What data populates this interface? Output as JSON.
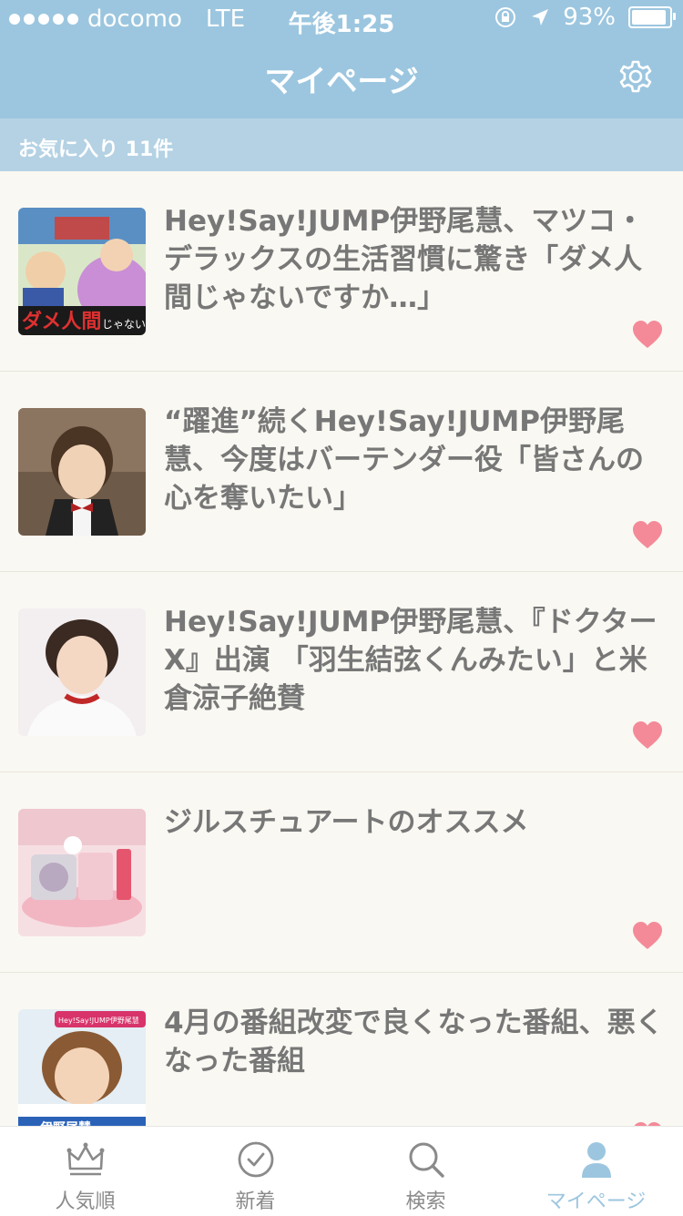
{
  "status": {
    "carrier": "docomo",
    "network": "LTE",
    "time": "午後1:25",
    "battery": "93%",
    "battery_level": 0.93
  },
  "nav": {
    "title": "マイページ",
    "settings_icon": "gear-icon"
  },
  "subheader": {
    "text": "お気に入り 11件"
  },
  "articles": [
    {
      "title": "Hey!Say!JUMP伊野尾慧、マツコ・デラックスの生活習慣に驚き「ダメ人間じゃないですか…」",
      "favorite": true
    },
    {
      "title": "“躍進”続くHey!Say!JUMP伊野尾慧、今度はバーテンダー役「皆さんの心を奪いたい」",
      "favorite": true
    },
    {
      "title": "Hey!Say!JUMP伊野尾慧、『ドクターX』出演 「羽生結弦くんみたい」と米倉涼子絶賛",
      "favorite": true
    },
    {
      "title": "ジルスチュアートのオススメ",
      "favorite": true
    },
    {
      "title": "4月の番組改変で良くなった番組、悪くなった番組",
      "favorite": true
    }
  ],
  "thumb_texts": {
    "t1": "ダメ人間",
    "t1_sub": "じゃない",
    "t5_banner": "Hey!Say!JUMP伊野尾慧",
    "t5_name": "伊野尾慧"
  },
  "tabs": [
    {
      "label": "人気順",
      "icon": "crown-icon"
    },
    {
      "label": "新着",
      "icon": "clock-icon"
    },
    {
      "label": "検索",
      "icon": "search-icon"
    },
    {
      "label": "マイページ",
      "icon": "person-icon",
      "active": true
    }
  ],
  "colors": {
    "accent": "#9cc6df",
    "heart": "#f48a98",
    "text": "#777777"
  }
}
